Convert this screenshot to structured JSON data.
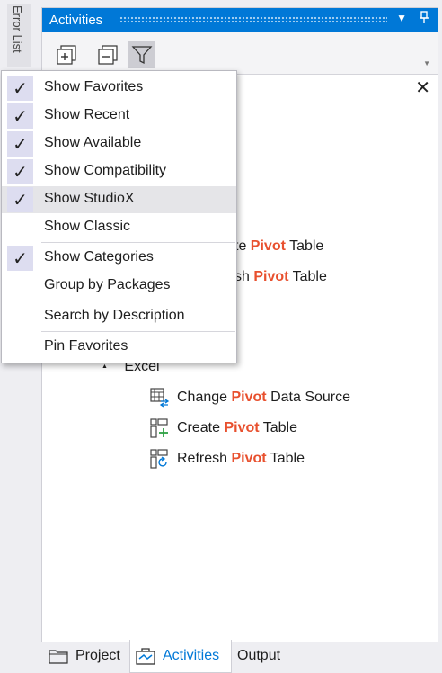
{
  "side_tab": {
    "label": "Error List"
  },
  "panel": {
    "title": "Activities",
    "toolbar": {
      "expand_tooltip": "Expand All",
      "collapse_tooltip": "Collapse All",
      "filter_tooltip": "Filter"
    }
  },
  "menu": {
    "items": [
      {
        "label": "Show Favorites",
        "checked": true
      },
      {
        "label": "Show Recent",
        "checked": true
      },
      {
        "label": "Show Available",
        "checked": true
      },
      {
        "label": "Show Compatibility",
        "checked": true
      },
      {
        "label": "Show StudioX",
        "checked": true,
        "hover": true
      },
      {
        "label": "Show Classic",
        "checked": false
      },
      {
        "label": "Show Categories",
        "checked": true
      },
      {
        "label": "Group by Packages",
        "checked": false
      },
      {
        "label": "Search by Description",
        "checked": false
      },
      {
        "label": "Pin Favorites",
        "checked": false
      }
    ],
    "check_glyph": "✓"
  },
  "tree": {
    "partial_rows": [
      {
        "prefix": "te ",
        "highlight": "Pivot",
        "suffix": " Table"
      },
      {
        "prefix": "sh ",
        "highlight": "Pivot",
        "suffix": " Table"
      }
    ],
    "group": {
      "toggle": "▲",
      "label": "Excel"
    },
    "items": [
      {
        "prefix": "Change ",
        "highlight": "Pivot",
        "suffix": " Data Source",
        "icon": "change-pivot-source-icon"
      },
      {
        "prefix": "Create ",
        "highlight": "Pivot",
        "suffix": " Table",
        "icon": "create-pivot-table-icon"
      },
      {
        "prefix": "Refresh ",
        "highlight": "Pivot",
        "suffix": " Table",
        "icon": "refresh-pivot-table-icon"
      }
    ]
  },
  "bottom_tabs": [
    {
      "label": "Project",
      "active": false
    },
    {
      "label": "Activities",
      "active": true
    },
    {
      "label": "Output",
      "active": false
    }
  ],
  "colors": {
    "accent": "#0078d7",
    "highlight": "#e8502e",
    "check_bg": "#ddddf0"
  }
}
